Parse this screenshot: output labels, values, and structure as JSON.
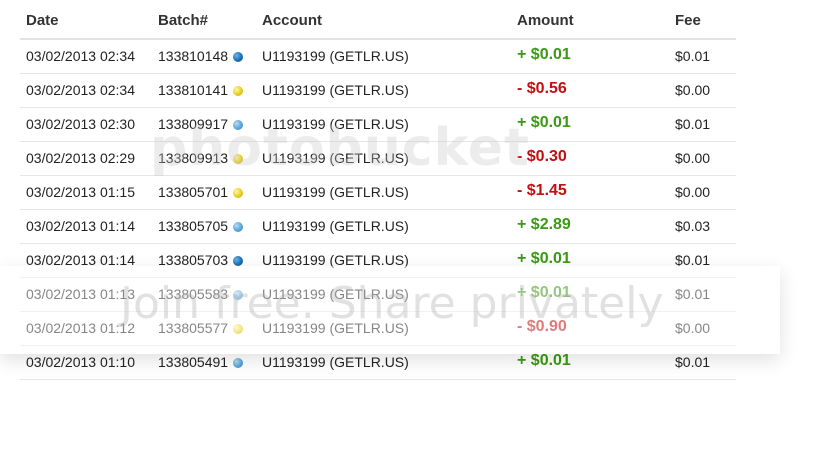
{
  "table": {
    "headers": {
      "date": "Date",
      "batch": "Batch#",
      "account": "Account",
      "amount": "Amount",
      "fee": "Fee"
    },
    "rows": [
      {
        "date": "03/02/2013 02:34",
        "batch": "133810148",
        "dot": "blue-dark",
        "account": "U1193199 (GETLR.US)",
        "amount": "+ $0.01",
        "sign": "pos",
        "fee": "$0.01"
      },
      {
        "date": "03/02/2013 02:34",
        "batch": "133810141",
        "dot": "yellow",
        "account": "U1193199 (GETLR.US)",
        "amount": "- $0.56",
        "sign": "neg",
        "fee": "$0.00"
      },
      {
        "date": "03/02/2013 02:30",
        "batch": "133809917",
        "dot": "blue-light",
        "account": "U1193199 (GETLR.US)",
        "amount": "+ $0.01",
        "sign": "pos",
        "fee": "$0.01"
      },
      {
        "date": "03/02/2013 02:29",
        "batch": "133809913",
        "dot": "yellow",
        "account": "U1193199 (GETLR.US)",
        "amount": "- $0.30",
        "sign": "neg",
        "fee": "$0.00"
      },
      {
        "date": "03/02/2013 01:15",
        "batch": "133805701",
        "dot": "yellow",
        "account": "U1193199 (GETLR.US)",
        "amount": "- $1.45",
        "sign": "neg",
        "fee": "$0.00"
      },
      {
        "date": "03/02/2013 01:14",
        "batch": "133805705",
        "dot": "blue-light",
        "account": "U1193199 (GETLR.US)",
        "amount": "+ $2.89",
        "sign": "pos",
        "fee": "$0.03"
      },
      {
        "date": "03/02/2013 01:14",
        "batch": "133805703",
        "dot": "blue-dark",
        "account": "U1193199 (GETLR.US)",
        "amount": "+ $0.01",
        "sign": "pos",
        "fee": "$0.01"
      },
      {
        "date": "03/02/2013 01:13",
        "batch": "133805583",
        "dot": "blue-light",
        "account": "U1193199 (GETLR.US)",
        "amount": "+ $0.01",
        "sign": "pos",
        "fee": "$0.01"
      },
      {
        "date": "03/02/2013 01:12",
        "batch": "133805577",
        "dot": "yellow",
        "account": "U1193199 (GETLR.US)",
        "amount": "- $0.90",
        "sign": "neg",
        "fee": "$0.00"
      },
      {
        "date": "03/02/2013 01:10",
        "batch": "133805491",
        "dot": "blue-light",
        "account": "U1193199 (GETLR.US)",
        "amount": "+ $0.01",
        "sign": "pos",
        "fee": "$0.01"
      }
    ]
  },
  "watermark": {
    "logo_text": "photobucket",
    "tagline": "Join free. Share privately"
  },
  "colors": {
    "positive": "#3a9a12",
    "negative": "#c20f0f",
    "dot_blue_dark": "#1a6fb6",
    "dot_blue_light": "#5aa5d8",
    "dot_yellow": "#e6cf1c"
  }
}
